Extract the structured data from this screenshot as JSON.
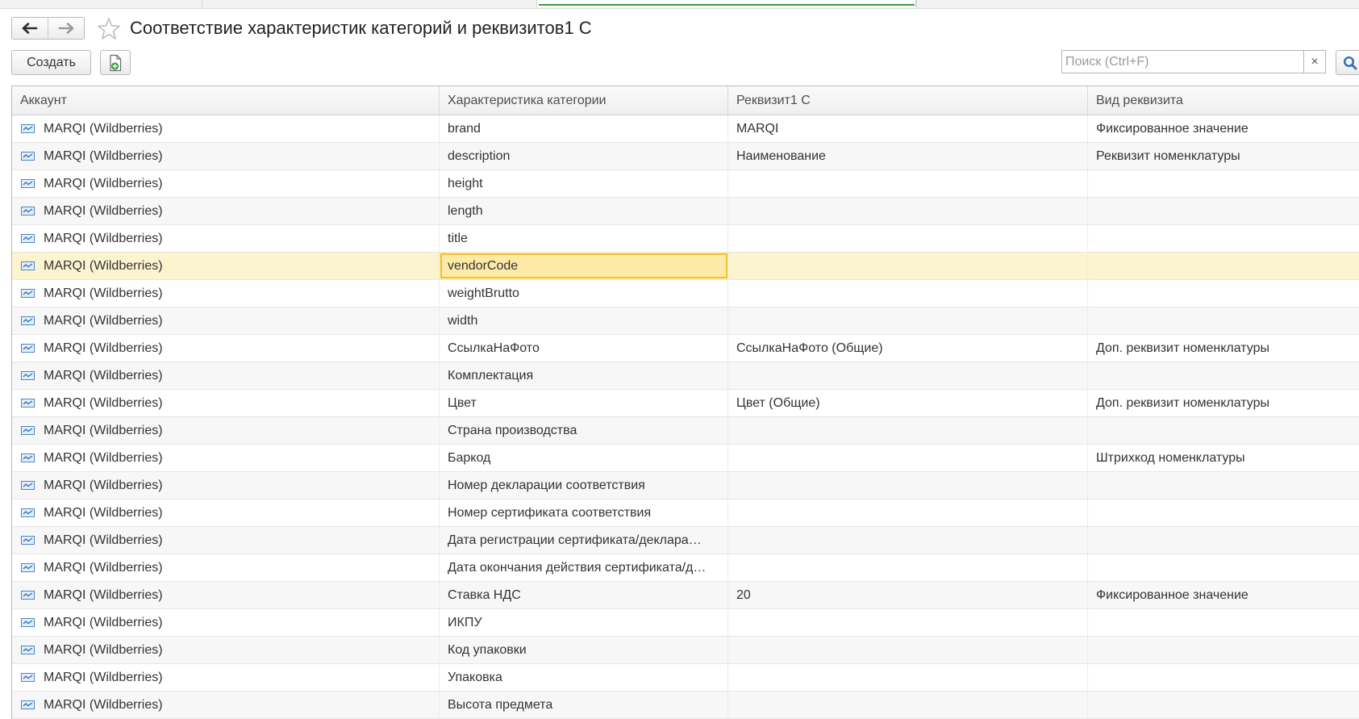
{
  "window": {
    "title": "Соответствие характеристик категорий и реквизитов1 С"
  },
  "toolbar": {
    "create_label": "Создать",
    "search_placeholder": "Поиск (Ctrl+F)",
    "search_value": "",
    "clear_label": "×"
  },
  "icons": {
    "back": "arrow-left-icon",
    "forward": "arrow-right-icon",
    "favorite": "star-outline-icon",
    "copy": "document-add-icon",
    "search": "magnifier-icon",
    "row": "catalog-item-icon"
  },
  "colors": {
    "selected_row": "#fcf3cf",
    "active_cell_border": "#f2c12e",
    "active_tab_line": "#3c9a3c",
    "search_icon": "#2a6fb5"
  },
  "table": {
    "columns": [
      "Аккаунт",
      "Характеристика категории",
      "Реквизит1 С",
      "Вид реквизита"
    ],
    "selected_index": 5,
    "rows": [
      {
        "account": "MARQI (Wildberries)",
        "characteristic": "brand",
        "requisite": "MARQI",
        "kind": "Фиксированное значение"
      },
      {
        "account": "MARQI (Wildberries)",
        "characteristic": "description",
        "requisite": "Наименование",
        "kind": "Реквизит номенклатуры"
      },
      {
        "account": "MARQI (Wildberries)",
        "characteristic": "height",
        "requisite": "",
        "kind": ""
      },
      {
        "account": "MARQI (Wildberries)",
        "characteristic": "length",
        "requisite": "",
        "kind": ""
      },
      {
        "account": "MARQI (Wildberries)",
        "characteristic": "title",
        "requisite": "",
        "kind": ""
      },
      {
        "account": "MARQI (Wildberries)",
        "characteristic": "vendorCode",
        "requisite": "",
        "kind": ""
      },
      {
        "account": "MARQI (Wildberries)",
        "characteristic": "weightBrutto",
        "requisite": "",
        "kind": ""
      },
      {
        "account": "MARQI (Wildberries)",
        "characteristic": "width",
        "requisite": "",
        "kind": ""
      },
      {
        "account": "MARQI (Wildberries)",
        "characteristic": "СсылкаНаФото",
        "requisite": "СсылкаНаФото (Общие)",
        "kind": "Доп. реквизит номенклатуры"
      },
      {
        "account": "MARQI (Wildberries)",
        "characteristic": "Комплектация",
        "requisite": "",
        "kind": ""
      },
      {
        "account": "MARQI (Wildberries)",
        "characteristic": "Цвет",
        "requisite": "Цвет (Общие)",
        "kind": "Доп. реквизит номенклатуры"
      },
      {
        "account": "MARQI (Wildberries)",
        "characteristic": "Страна производства",
        "requisite": "",
        "kind": ""
      },
      {
        "account": "MARQI (Wildberries)",
        "characteristic": "Баркод",
        "requisite": "",
        "kind": "Штрихкод номенклатуры"
      },
      {
        "account": "MARQI (Wildberries)",
        "characteristic": "Номер декларации соответствия",
        "requisite": "",
        "kind": ""
      },
      {
        "account": "MARQI (Wildberries)",
        "characteristic": "Номер сертификата соответствия",
        "requisite": "",
        "kind": ""
      },
      {
        "account": "MARQI (Wildberries)",
        "characteristic": "Дата регистрации сертификата/деклара…",
        "requisite": "",
        "kind": ""
      },
      {
        "account": "MARQI (Wildberries)",
        "characteristic": "Дата окончания действия сертификата/д…",
        "requisite": "",
        "kind": ""
      },
      {
        "account": "MARQI (Wildberries)",
        "characteristic": "Ставка НДС",
        "requisite": "20",
        "kind": "Фиксированное значение"
      },
      {
        "account": "MARQI (Wildberries)",
        "characteristic": "ИКПУ",
        "requisite": "",
        "kind": ""
      },
      {
        "account": "MARQI (Wildberries)",
        "characteristic": "Код упаковки",
        "requisite": "",
        "kind": ""
      },
      {
        "account": "MARQI (Wildberries)",
        "characteristic": "Упаковка",
        "requisite": "",
        "kind": ""
      },
      {
        "account": "MARQI (Wildberries)",
        "characteristic": "Высота предмета",
        "requisite": "",
        "kind": ""
      }
    ]
  }
}
